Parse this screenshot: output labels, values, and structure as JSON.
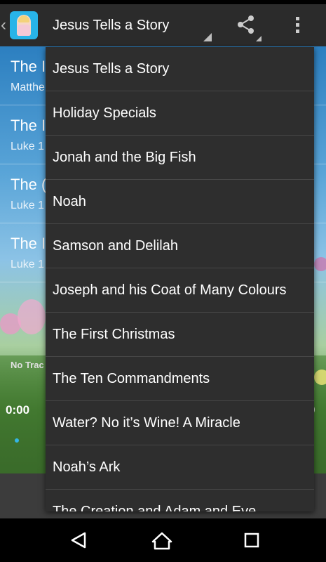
{
  "action_bar": {
    "back_icon": "chevron-left-icon",
    "app_icon": "jesus-app-icon",
    "spinner_title": "Jesus Tells a Story",
    "share_icon": "share-icon",
    "overflow_icon": "overflow-menu-icon",
    "accent_color": "#33b5e5"
  },
  "background_list": {
    "rows": [
      {
        "title": "The I",
        "subtitle": "Matthe"
      },
      {
        "title": "The I",
        "subtitle": "Luke 1"
      },
      {
        "title": "The (",
        "subtitle": "Luke 1"
      },
      {
        "title": "The I",
        "subtitle": "Luke 1"
      }
    ]
  },
  "player": {
    "no_track_label": "No Trac",
    "time_elapsed": "0:00",
    "time_total_fragment": "0"
  },
  "dropdown": {
    "items": [
      "Jesus Tells a Story",
      "Holiday Specials",
      "Jonah and the Big Fish",
      "Noah",
      "Samson and Delilah",
      "Joseph and his Coat of Many Colours",
      "The First Christmas",
      "The Ten Commandments",
      "Water? No it’s Wine! A Miracle",
      "Noah’s Ark",
      "The Creation and Adam and Eve"
    ]
  },
  "nav_bar": {
    "back_icon": "back-triangle-icon",
    "home_icon": "home-icon",
    "recents_icon": "recents-square-icon"
  }
}
